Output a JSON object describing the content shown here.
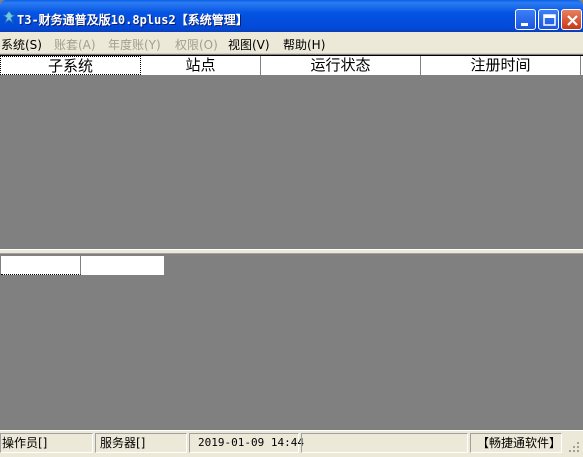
{
  "window": {
    "title": "T3-财务通普及版10.8plus2【系统管理】",
    "icons": {
      "app": "app-logo-icon",
      "minimize": "minimize-icon",
      "maximize": "maximize-icon",
      "close": "close-icon"
    }
  },
  "menu": [
    {
      "label": "系统(S)",
      "enabled": true
    },
    {
      "label": "账套(A)",
      "enabled": false
    },
    {
      "label": "年度账(Y)",
      "enabled": false
    },
    {
      "label": "权限(O)",
      "enabled": false
    },
    {
      "label": "视图(V)",
      "enabled": true
    },
    {
      "label": "帮助(H)",
      "enabled": true
    }
  ],
  "grid": {
    "columns": [
      "子系统",
      "站点",
      "运行状态",
      "注册时间"
    ],
    "rows": []
  },
  "lower_grid": {
    "columns": [
      "",
      ""
    ],
    "rows": []
  },
  "statusbar": {
    "operator": "操作员[]",
    "server": "服务器[]",
    "datetime": "2019-01-09 14:44",
    "blank": "",
    "brand": "【畅捷通软件】"
  },
  "colors": {
    "titlebar": "#0554e3",
    "workspace": "#808080",
    "chrome": "#ece9d8",
    "disabled_text": "#a29f90"
  }
}
